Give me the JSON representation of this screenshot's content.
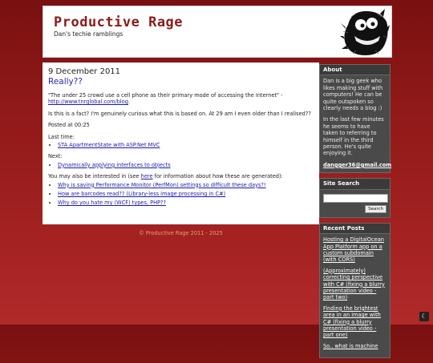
{
  "header": {
    "title": "Productive Rage",
    "subtitle": "Dan's techie ramblings"
  },
  "post": {
    "date": "9 December 2011",
    "title": "Really??",
    "quote": "\"The under 25 crowd use a cell phone as their primary mode of accessing the Internet\" -",
    "quote_link": "http://www.tnrglobal.com/blog",
    "quote_end": ".",
    "body": "Is this is a fact? I'm genuinely curious what this is based on. At 29 am I even older than I realised??",
    "posted_at": "Posted at 00:25",
    "last_time_label": "Last time:",
    "last_time_links": [
      "STA ApartmentState with ASP.Net MVC"
    ],
    "next_label": "Next:",
    "next_links": [
      "Dynamically applying interfaces to objects"
    ],
    "also_prefix": "You may also be interested in (see ",
    "also_here": "here",
    "also_suffix": " for information about how these are generated):",
    "also_links": [
      "Why is saving Performance Monitor (PerfMon) settings so difficult these days?!",
      "How are barcodes read?? (Library-less image processing in C#)",
      "Why do you hate my (WCF) types, PHP??"
    ]
  },
  "footer": "© Productive Rage 2011 - 2025",
  "sidebar": {
    "about_title": "About",
    "about_p1": "Dan is a big geek who likes making stuff with computers! He can be quite outspoken so clearly needs a blog :)",
    "about_p2": "In the last few minutes he seems to have taken to referring to himself in the third person. He's quite enjoying it.",
    "email": "dangger36@gmail.com",
    "search_title": "Site Search",
    "search_button": "Search",
    "recent_title": "Recent Posts",
    "recent_links": [
      "Hosting a DigitalOcean App Platform app on a custom subdomain (with CORS)",
      "(Approximately) correcting perspective with C# (fixing a blurry presentation video - part two)",
      "Finding the brightest area in an image with C# (fixing a blurry presentation video - part one)",
      "So.. what is machine"
    ]
  },
  "theme_toggle_icon": "moon-icon"
}
